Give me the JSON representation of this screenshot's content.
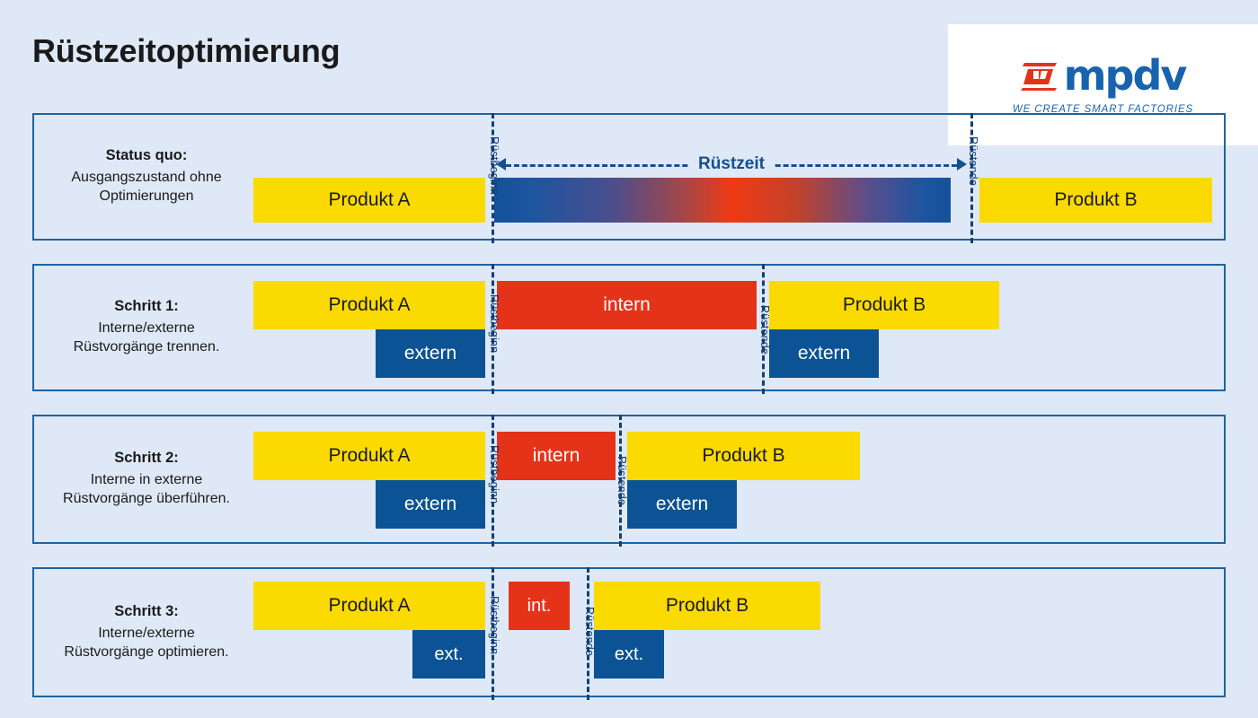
{
  "page": {
    "title": "Rüstzeitoptimierung",
    "background_color": "#dfe8f6",
    "panel_border_color": "#2063a0"
  },
  "logo": {
    "wordmark": "mpdv",
    "tagline": "WE CREATE SMART FACTORIES",
    "brand_blue": "#1763ae",
    "brand_red": "#e5331a"
  },
  "colors": {
    "yellow": "#fada00",
    "blue": "#0b5394",
    "red": "#e5331a",
    "dark_blue_line": "#123f75",
    "gradient_start": "#14529a",
    "gradient_mid": "#ef3a14",
    "gradient_end": "#14529a"
  },
  "markers": {
    "start": "Rüstbeginn",
    "end": "Rüstende",
    "duration": "Rüstzeit"
  },
  "rows": [
    {
      "caption_title": "Status quo:",
      "caption_lines": [
        "Ausgangszustand ohne",
        "Optimierungen"
      ],
      "bars": [
        {
          "label": "Produkt A",
          "kind": "yellow"
        },
        {
          "label": "",
          "kind": "gradient"
        },
        {
          "label": "Produkt B",
          "kind": "yellow"
        }
      ]
    },
    {
      "caption_title": "Schritt 1:",
      "caption_lines": [
        "Interne/externe",
        "Rüstvorgänge trennen."
      ],
      "bars": [
        {
          "label": "Produkt A",
          "kind": "yellow"
        },
        {
          "label": "extern",
          "kind": "blue"
        },
        {
          "label": "intern",
          "kind": "red"
        },
        {
          "label": "Produkt B",
          "kind": "yellow"
        },
        {
          "label": "extern",
          "kind": "blue"
        }
      ]
    },
    {
      "caption_title": "Schritt 2:",
      "caption_lines": [
        "Interne in externe",
        "Rüstvorgänge überführen."
      ],
      "bars": [
        {
          "label": "Produkt A",
          "kind": "yellow"
        },
        {
          "label": "extern",
          "kind": "blue"
        },
        {
          "label": "intern",
          "kind": "red"
        },
        {
          "label": "Produkt B",
          "kind": "yellow"
        },
        {
          "label": "extern",
          "kind": "blue"
        }
      ]
    },
    {
      "caption_title": "Schritt 3:",
      "caption_lines": [
        "Interne/externe",
        "Rüstvorgänge optimieren."
      ],
      "bars": [
        {
          "label": "Produkt A",
          "kind": "yellow"
        },
        {
          "label": "ext.",
          "kind": "blue"
        },
        {
          "label": "int.",
          "kind": "red"
        },
        {
          "label": "Produkt B",
          "kind": "yellow"
        },
        {
          "label": "ext.",
          "kind": "blue"
        }
      ]
    }
  ]
}
